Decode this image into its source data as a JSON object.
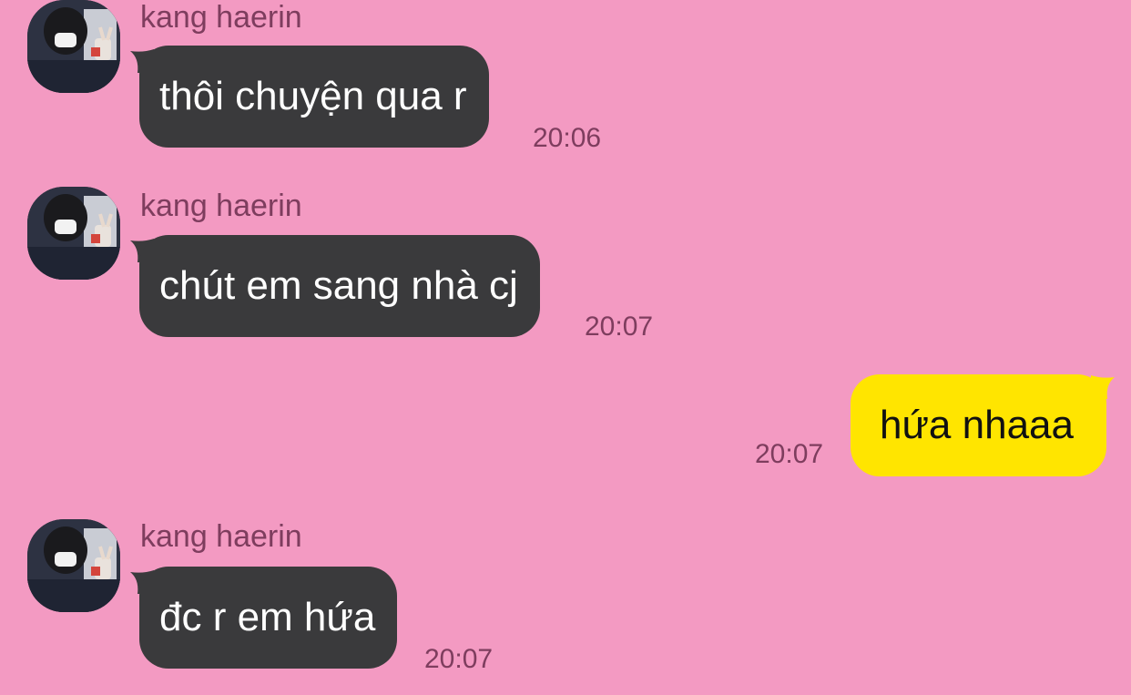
{
  "conversation": {
    "messages": [
      {
        "direction": "incoming",
        "sender": "kang haerin",
        "text": "thôi chuyện qua r",
        "time": "20:06"
      },
      {
        "direction": "incoming",
        "sender": "kang haerin",
        "text": "chút em sang nhà cj",
        "time": "20:07"
      },
      {
        "direction": "outgoing",
        "text": "hứa nhaaa",
        "time": "20:07"
      },
      {
        "direction": "incoming",
        "sender": "kang haerin",
        "text": "đc r em hứa",
        "time": "20:07"
      }
    ]
  },
  "colors": {
    "background": "#f39ac2",
    "incoming_bubble": "#3a3a3c",
    "outgoing_bubble": "#ffe500",
    "meta_text": "#7e3d5e"
  }
}
